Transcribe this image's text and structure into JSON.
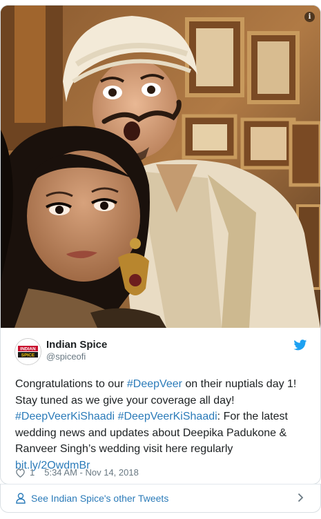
{
  "media": {
    "info_label": "i",
    "alt": ""
  },
  "author": {
    "name": "Indian Spice",
    "handle": "@spiceofi",
    "avatar_text_1": "INDIAN",
    "avatar_text_2": "SPICE"
  },
  "tweet": {
    "t1": "Congratulations to our ",
    "h1": "#DeepVeer",
    "t2": " on their nuptials day 1! Stay tuned as we give your coverage all day! ",
    "h2": "#DeepVeerKiShaadi",
    "t3": " ",
    "h3": "#DeepVeerKiShaadi",
    "t4": ": For the latest wedding news and updates about Deepika Padukone & Ranveer Singh’s wedding visit here regularly ",
    "link": "bit.ly/2OwdmBr"
  },
  "meta": {
    "likes": "1",
    "timestamp": "5:34 AM - Nov 14, 2018"
  },
  "footer": {
    "see_more": "See Indian Spice's other Tweets"
  },
  "colors": {
    "link": "#2b7bb9",
    "muted": "#697882",
    "twitter_blue": "#1da1f2",
    "border": "#d9dfe3"
  },
  "icons": {
    "bird": "twitter-bird-icon",
    "heart": "heart-icon",
    "person": "person-icon",
    "chevron": "chevron-right-icon",
    "info": "info-icon"
  }
}
